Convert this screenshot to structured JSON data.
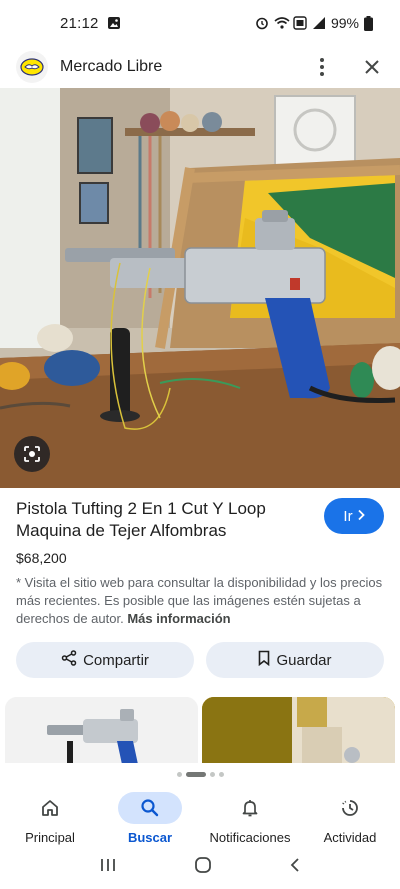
{
  "status_bar": {
    "time": "21:12",
    "battery": "99%"
  },
  "header": {
    "site_name": "Mercado Libre",
    "logo_icon": "handshake-icon",
    "menu_icon": "more-vert-icon",
    "close_icon": "close-icon"
  },
  "hero": {
    "lens_icon": "google-lens-icon"
  },
  "product": {
    "title": "Pistola Tufting 2 En 1 Cut Y Loop Maquina de Tejer Alfombras",
    "price": "$68,200",
    "go_label": "Ir",
    "go_color": "#1a73e8"
  },
  "disclaimer": {
    "text": "* Visita el sitio web para consultar la disponibilidad y los precios más recientes. Es posible que las imágenes estén sujetas a derechos de autor. ",
    "more_link": "Más información"
  },
  "actions": {
    "share_label": "Compartir",
    "save_label": "Guardar"
  },
  "bottom_nav": {
    "items": [
      {
        "label": "Principal",
        "icon": "home-icon"
      },
      {
        "label": "Buscar",
        "icon": "search-icon"
      },
      {
        "label": "Notificaciones",
        "icon": "bell-icon"
      },
      {
        "label": "Actividad",
        "icon": "activity-icon"
      }
    ],
    "active_color": "#0b57d0"
  }
}
